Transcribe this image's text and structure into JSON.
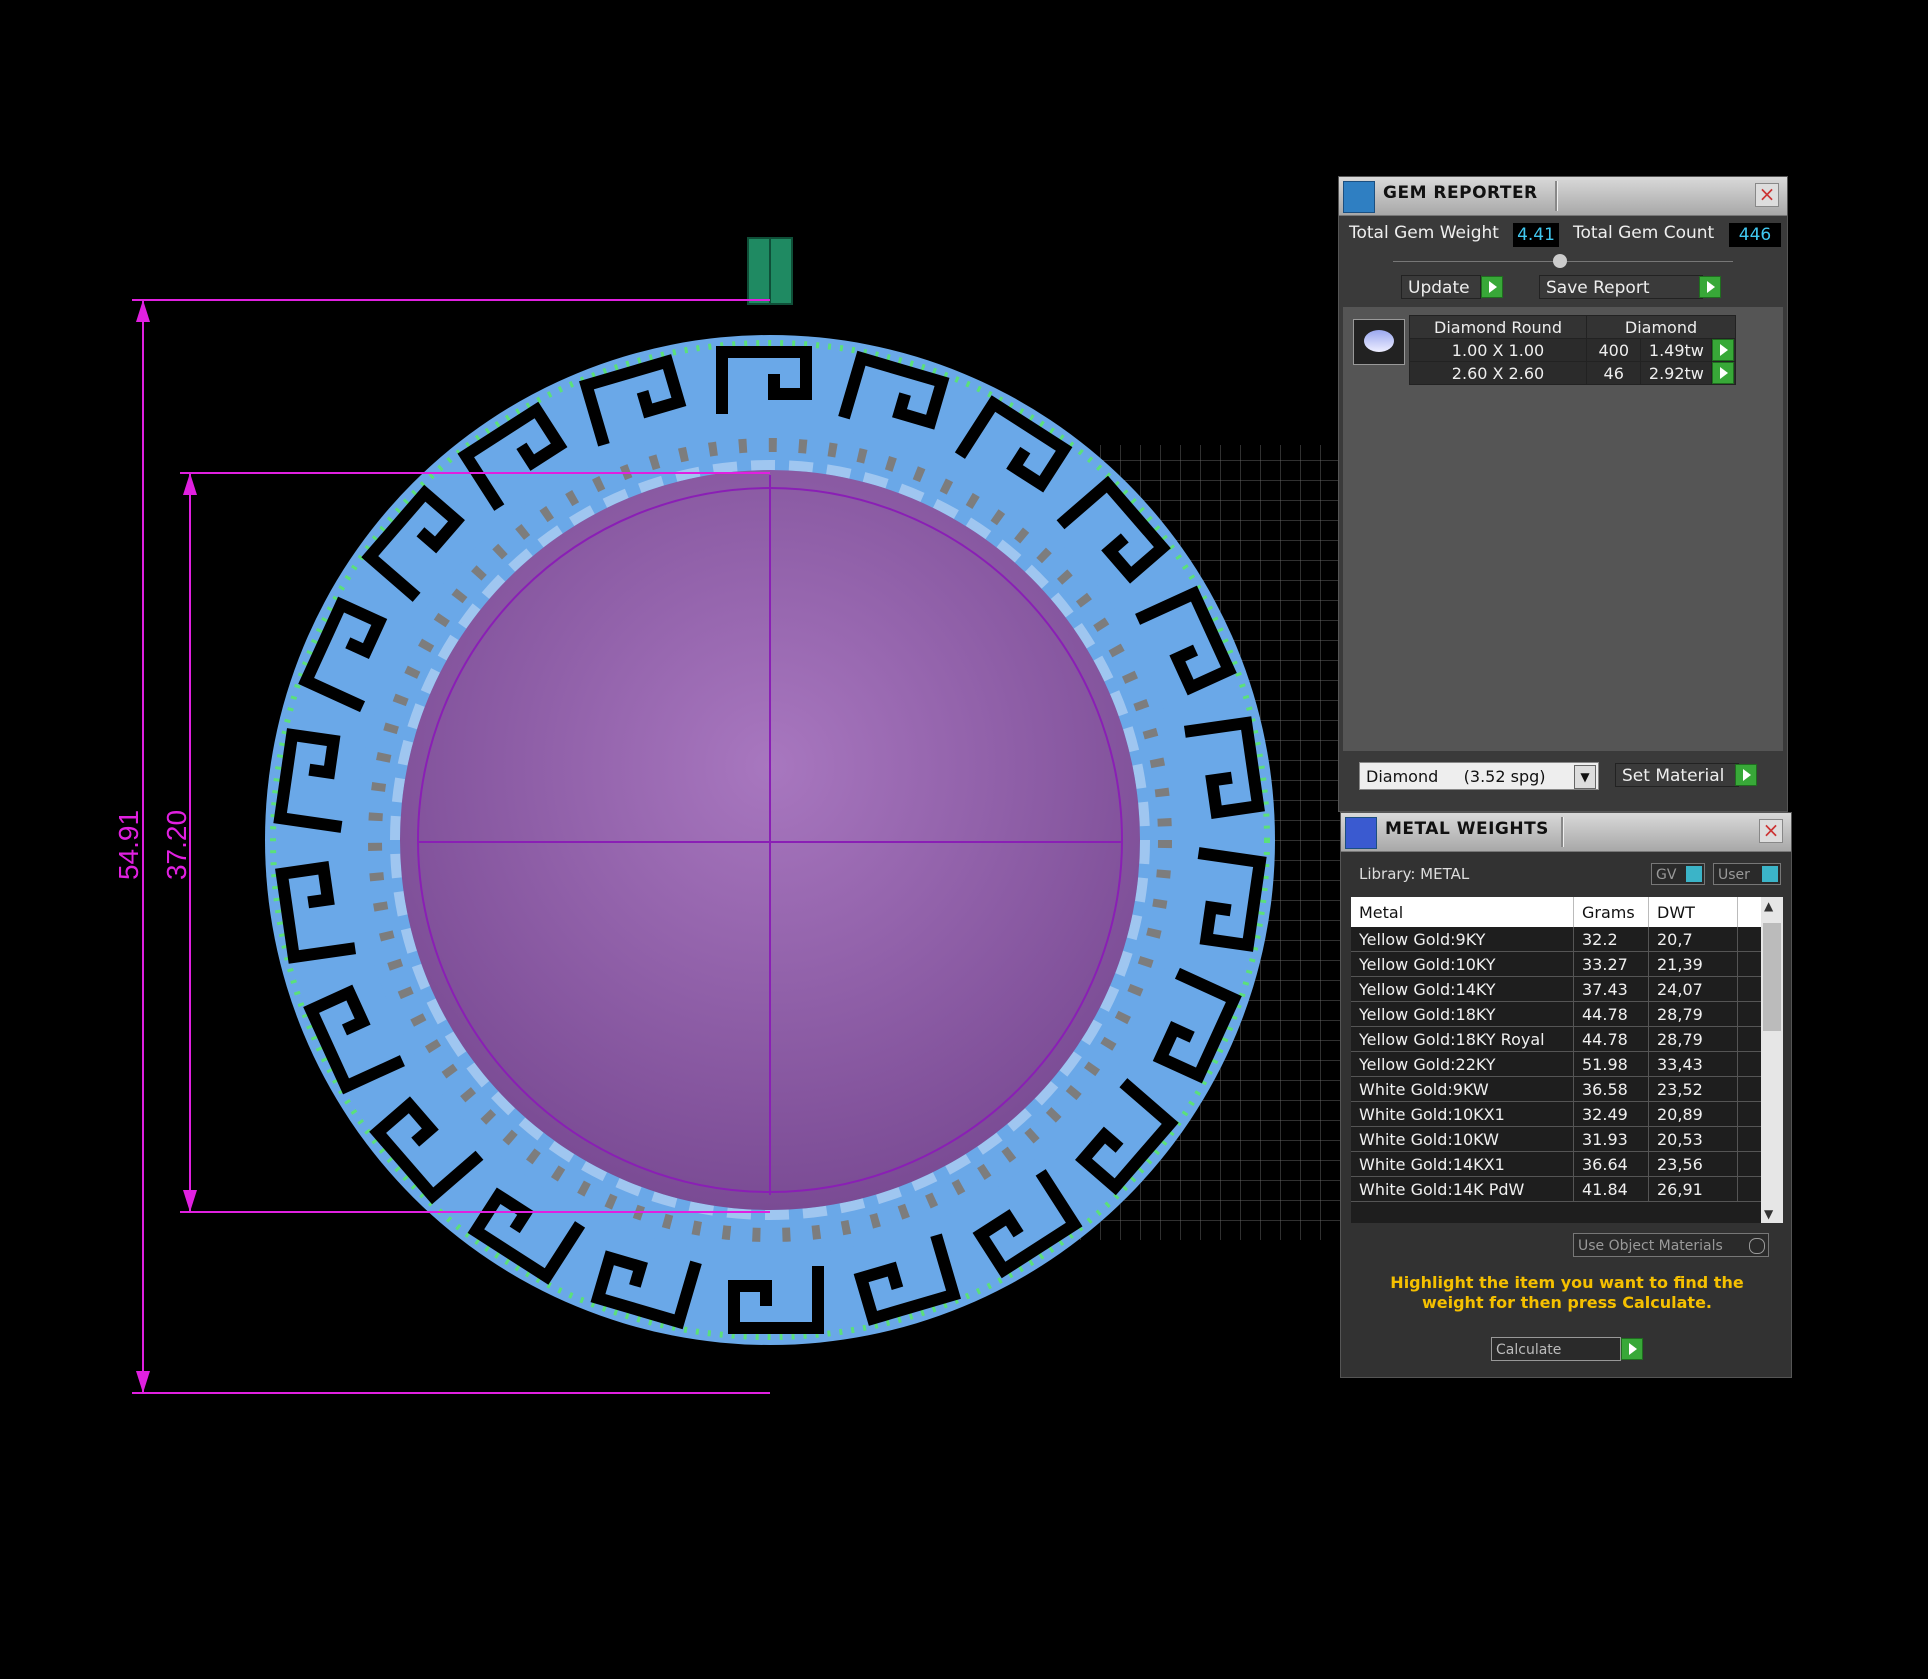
{
  "dimensions": {
    "outer": "54.91",
    "inner": "37.20"
  },
  "gem_reporter": {
    "title": "GEM REPORTER",
    "total_weight_label": "Total Gem Weight",
    "total_weight_value": "4.41",
    "total_count_label": "Total Gem Count",
    "total_count_value": "446",
    "update_label": "Update",
    "save_report_label": "Save Report",
    "table": {
      "headers": [
        "Diamond Round",
        "Diamond"
      ],
      "rows": [
        {
          "size": "1.00 X 1.00",
          "count": "400",
          "tw": "1.49tw"
        },
        {
          "size": "2.60 X 2.60",
          "count": "46",
          "tw": "2.92tw"
        }
      ]
    },
    "material_select": "Diamond     (3.52 spg)",
    "set_material_label": "Set Material"
  },
  "metal_weights": {
    "title": "METAL WEIGHTS",
    "library_label": "Library: METAL",
    "gv_label": "GV",
    "user_label": "User",
    "columns": [
      "Metal",
      "Grams",
      "DWT"
    ],
    "rows": [
      {
        "metal": "Yellow Gold:9KY",
        "grams": "32.2",
        "dwt": "20,7"
      },
      {
        "metal": "Yellow Gold:10KY",
        "grams": "33.27",
        "dwt": "21,39"
      },
      {
        "metal": "Yellow Gold:14KY",
        "grams": "37.43",
        "dwt": "24,07"
      },
      {
        "metal": "Yellow Gold:18KY",
        "grams": "44.78",
        "dwt": "28,79"
      },
      {
        "metal": "Yellow Gold:18KY Royal",
        "grams": "44.78",
        "dwt": "28,79"
      },
      {
        "metal": "Yellow Gold:22KY",
        "grams": "51.98",
        "dwt": "33,43"
      },
      {
        "metal": "White Gold:9KW",
        "grams": "36.58",
        "dwt": "23,52"
      },
      {
        "metal": "White Gold:10KX1",
        "grams": "32.49",
        "dwt": "20,89"
      },
      {
        "metal": "White Gold:10KW",
        "grams": "31.93",
        "dwt": "20,53"
      },
      {
        "metal": "White Gold:14KX1",
        "grams": "36.64",
        "dwt": "23,56"
      },
      {
        "metal": "White Gold:14K PdW",
        "grams": "41.84",
        "dwt": "26,91"
      }
    ],
    "use_object_materials_label": "Use Object Materials",
    "hint": "Highlight the item you want to find the weight for then press Calculate.",
    "calculate_label": "Calculate"
  }
}
